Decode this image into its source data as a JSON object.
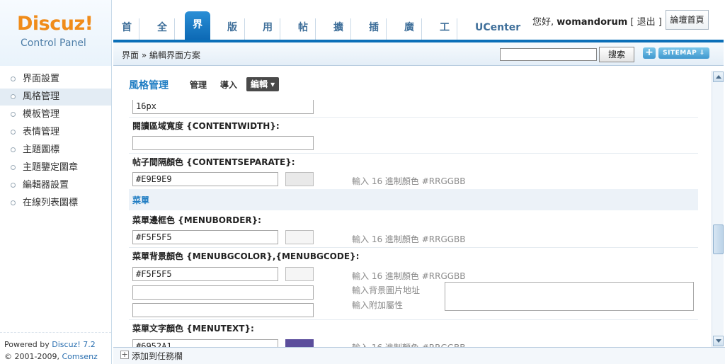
{
  "logo": {
    "brand": "Discuz!",
    "subtitle": "Control Panel"
  },
  "nav": {
    "items": [
      "首頁",
      "全局",
      "界面",
      "版塊",
      "用戶",
      "帖子",
      "擴展",
      "插件",
      "廣告",
      "工具",
      "UCenter"
    ],
    "active": "界面"
  },
  "user": {
    "greeting": "您好,",
    "name": "womandorum",
    "logout": "[ 退出 ]",
    "home_button": "論壇首頁"
  },
  "crumb": {
    "text": "界面 » 編輯界面方案"
  },
  "search": {
    "value": "",
    "button": "搜索"
  },
  "tools": {
    "plus": "+",
    "sitemap": "SITEMAP ⇩"
  },
  "sidebar": {
    "items": [
      "界面設置",
      "風格管理",
      "模板管理",
      "表情管理",
      "主題圖標",
      "主題鑒定圖章",
      "編輯器設置",
      "在線列表圖標"
    ],
    "active_index": 1,
    "footer_line1_pre": "Powered by ",
    "footer_line1_link": "Discuz! 7.2",
    "footer_line2_pre": "© 2001-2009, ",
    "footer_line2_link": "Comsenz Inc."
  },
  "subtabs": {
    "title": "風格管理",
    "tab1": "管理",
    "tab2": "導入",
    "tab3": "編輯 ▾"
  },
  "form": {
    "font_value": "16px",
    "contentwidth_label": "閱讀區域寬度 {CONTENTWIDTH}:",
    "contentwidth_value": "",
    "separate_label": "帖子間隔顏色 {CONTENTSEPARATE}:",
    "separate_value": "#E9E9E9",
    "separate_color": "#E9E9E9",
    "hint": "輸入 16 進制顏色 #RRGGBB",
    "section_menu": "菜單",
    "menuborder_label": "菜單邊框色 {MENUBORDER}:",
    "menuborder_value": "#F5F5F5",
    "menuborder_color": "#F5F5F5",
    "menubg_label": "菜單背景顏色 {MENUBGCOLOR},{MENUBGCODE}:",
    "menubg_value": "#F5F5F5",
    "menubg_color": "#F5F5F5",
    "menubg_img_hint": "輸入背景圖片地址",
    "menubg_attr_hint": "輸入附加屬性",
    "menutext_label": "菜單文字顏色 {MENUTEXT}:",
    "menutext_value": "#6952A1",
    "menutext_color": "#5B4E9C"
  },
  "bottombar": {
    "label": "添加到任務欄"
  }
}
